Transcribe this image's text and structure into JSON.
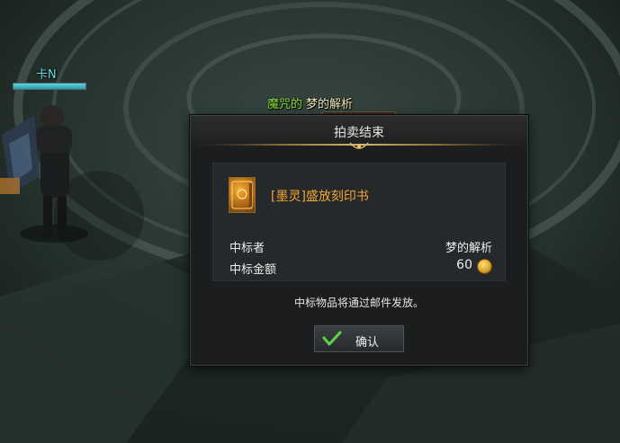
{
  "player": {
    "name": "卡N",
    "hp_fraction": 1.0
  },
  "npc": {
    "guild": "魔咒的",
    "name": "梦的解析",
    "hp_fraction": 0.0
  },
  "dialog": {
    "title": "拍卖结束",
    "item": {
      "icon": "spellbook-icon",
      "name": "[墨灵]盛放刻印书",
      "name_color": "#f0a532"
    },
    "winner_label": "中标者",
    "winner_value": "梦的解析",
    "price_label": "中标金额",
    "price_value": "60",
    "currency_icon": "gold-coin-icon",
    "notice": "中标物品将通过邮件发放。",
    "confirm_label": "确认",
    "confirm_icon": "check-icon"
  },
  "colors": {
    "guild": "#8ee03a",
    "player_name": "#6fd8e6",
    "confirm_check": "#5fd34a"
  }
}
